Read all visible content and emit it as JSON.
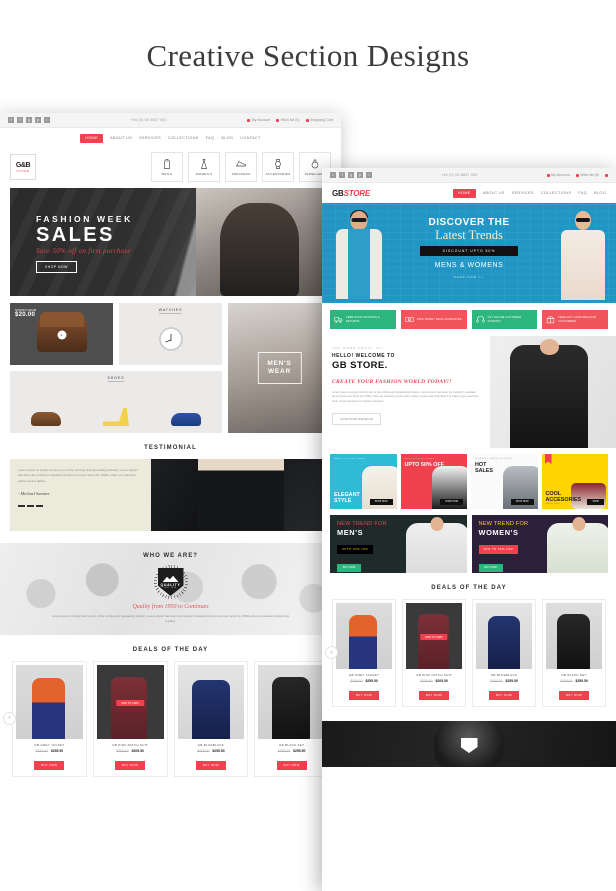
{
  "page": {
    "title": "Creative Section Designs"
  },
  "mockup_a": {
    "topbar": {
      "phone": "+44 (0) 00 8847 000",
      "links": [
        {
          "label": "My Account",
          "icon": "user-icon"
        },
        {
          "label": "Wish list (0)",
          "icon": "heart-icon"
        },
        {
          "label": "Shopping Cart",
          "icon": "cart-icon"
        }
      ],
      "socials": [
        "twitter-icon",
        "facebook-icon",
        "google-plus-icon",
        "pinterest-icon",
        "instagram-icon"
      ]
    },
    "nav": [
      "HOME",
      "ABOUT US",
      "SERVICES",
      "COLLECTIONS",
      "FAQ",
      "BLOG",
      "CONTACT"
    ],
    "logo": {
      "line1": "G&B",
      "line2": "STORE"
    },
    "categories": [
      {
        "label": "MEN'S",
        "icon": "hoodie-icon"
      },
      {
        "label": "WOMEN'S",
        "icon": "dress-icon"
      },
      {
        "label": "SNEAKERS",
        "icon": "sneaker-icon"
      },
      {
        "label": "ACCESSORIES",
        "icon": "watch-icon"
      },
      {
        "label": "JEWELLERY",
        "icon": "ring-icon"
      }
    ],
    "hero": {
      "line1": "FASHION WEEK",
      "line2": "SALES",
      "line3": "Save 50% off on first purchase",
      "button": "SHOP NOW"
    },
    "category_grid": {
      "bag": {
        "kicker": "STARTS FROM",
        "price": "$20.00",
        "zoom_icon": "magnifier-icon"
      },
      "watches_label": "WATCHES",
      "shoes_label": "SHOES",
      "menswear_line1": "MEN'S",
      "menswear_line2": "WEAR"
    },
    "testimonial": {
      "title": "TESTIMONIAL",
      "quote": "Lorem ipsum is simply dummy text of the printing and typesetting industry. Lorem ipsum has been the industry's standard dummy text ever since the 1500s, when an unknown printer took a galley.",
      "author": "- Michael Santner"
    },
    "who_we_are": {
      "title": "WHO WE ARE?",
      "badge_text": "QUALITY",
      "badge_est": "EST 1950",
      "tagline": "Quality from 1950 to Continues",
      "body": "Lorem ipsum is simply dummy text of the printing and typesetting industry. Lorem ipsum has been the industry's standard dummy text ever since the 1500s when an unknown printer took a galley."
    },
    "deals": {
      "title": "DEALS OF THE DAY",
      "prev_icon": "chevron-left-icon",
      "next_icon": "chevron-right-icon",
      "products": [
        {
          "name": "GB GREY JACKET",
          "old_price": "$395.50",
          "price": "$255.50",
          "button": "BUY NOW"
        },
        {
          "name": "GB PINK PATCH SUIT",
          "old_price": "$395.50",
          "price": "$205.50",
          "button": "BUY NOW",
          "badge": "ADD TO CART"
        },
        {
          "name": "GB BLUEBLACK",
          "old_price": "$395.50",
          "price": "$255.50",
          "button": "BUY NOW"
        },
        {
          "name": "GB BLACK SET",
          "old_price": "$395.50",
          "price": "$255.50",
          "button": "BUY NOW"
        }
      ]
    }
  },
  "mockup_b": {
    "topbar": {
      "phone": "+44 (0) 00 8847 000",
      "links": [
        {
          "label": "My Account",
          "icon": "user-icon"
        },
        {
          "label": "Wish list (0)",
          "icon": "heart-icon"
        },
        {
          "label": "Shopping Cart",
          "icon": "cart-icon"
        }
      ]
    },
    "logo": {
      "part1": "GB",
      "part2": "STORE"
    },
    "nav": [
      "HOME",
      "ABOUT US",
      "SERVICES",
      "COLLECTIONS",
      "FAQ",
      "BLOG"
    ],
    "hero": {
      "line1": "DISCOVER THE",
      "line2": "Latest Trends",
      "band": "DISCOUNT UPTO 50%",
      "line3": "MENS & WOMENS",
      "line4": "SHOP NOW >>"
    },
    "services": [
      {
        "label": "FREE DOOR SHIPPING & RETURNS",
        "icon": "truck-icon",
        "color": "#2cb67d"
      },
      {
        "label": "100% MONEY BACK GUARANTEE",
        "icon": "money-icon",
        "color": "#f0555c"
      },
      {
        "label": "24/7 ONLINE CUSTOMER SUPPORT",
        "icon": "headset-icon",
        "color": "#2cb67d"
      },
      {
        "label": "FREE GIFT CARD REGULAR CUSTOMERS",
        "icon": "gift-icon",
        "color": "#f0555c"
      }
    ],
    "about": {
      "kicker": "SEE MORE ABOUT US!",
      "welcome": "HELLO! WELCOME TO",
      "brand": "GB STORE.",
      "script": "CREATE YOUR FASHION WORLD TODAY!!",
      "body": "Lorem ipsum is simply dummy text of the printing and typesetting industry. Lorem ipsum has been the industry's standard dummy text ever since the 1500s, when an unknown printer took a galley of type and scrambled it to make a type specimen book. It has survived not only five centuries.",
      "button": "CONTINUE READING"
    },
    "promos": [
      {
        "kicker": "MEN'S COLLECTIONS",
        "title1": "ELEGANT",
        "title2": "STYLE",
        "button": "SHOP NOW",
        "color": "#2fbad6"
      },
      {
        "kicker": "KID'S COLLECTIONS",
        "title1": "UPTO 50% OFF",
        "title2": "",
        "button": "SHOP NOW",
        "color": "#f0414f"
      },
      {
        "kicker": "WOMEN'S FASHION WEEK",
        "title1": "HOT",
        "title2": "SALES",
        "button": "SHOP NOW",
        "color": "#fafafa"
      },
      {
        "kicker": "",
        "title1": "COOL",
        "title2": "ACCESORIES",
        "sub": "SAVE 30%",
        "button": "SHOP",
        "color": "#ffd400"
      }
    ],
    "trends": [
      {
        "line1": "NEW TREND FOR",
        "line2": "MEN'S",
        "tag": "UPTO 50% OFF",
        "button": "BUY NOW"
      },
      {
        "line1": "NEW TREND FOR",
        "line2": "WOMEN'S",
        "tag": "35% TO 50% OFF",
        "button": "BUY NOW"
      }
    ],
    "deals": {
      "title": "DEALS OF THE DAY",
      "prev_icon": "chevron-left-icon",
      "products": [
        {
          "name": "GB GREY JACKET",
          "old_price": "$395.50",
          "price": "$255.50",
          "button": "BUY NOW"
        },
        {
          "name": "GB PINK PATCH SUIT",
          "old_price": "$395.50",
          "price": "$205.50",
          "button": "BUY NOW",
          "badge": "ADD TO CART"
        },
        {
          "name": "GB BLUEBLACK",
          "old_price": "$395.50",
          "price": "$255.50",
          "button": "BUY NOW"
        },
        {
          "name": "GB BLACK SET",
          "old_price": "$395.50",
          "price": "$255.50",
          "button": "BUY NOW"
        }
      ]
    }
  },
  "colors": {
    "accent_red": "#f2404e",
    "green": "#2cb67d",
    "hero_blue": "#2196c4",
    "yellow": "#ffd400"
  }
}
